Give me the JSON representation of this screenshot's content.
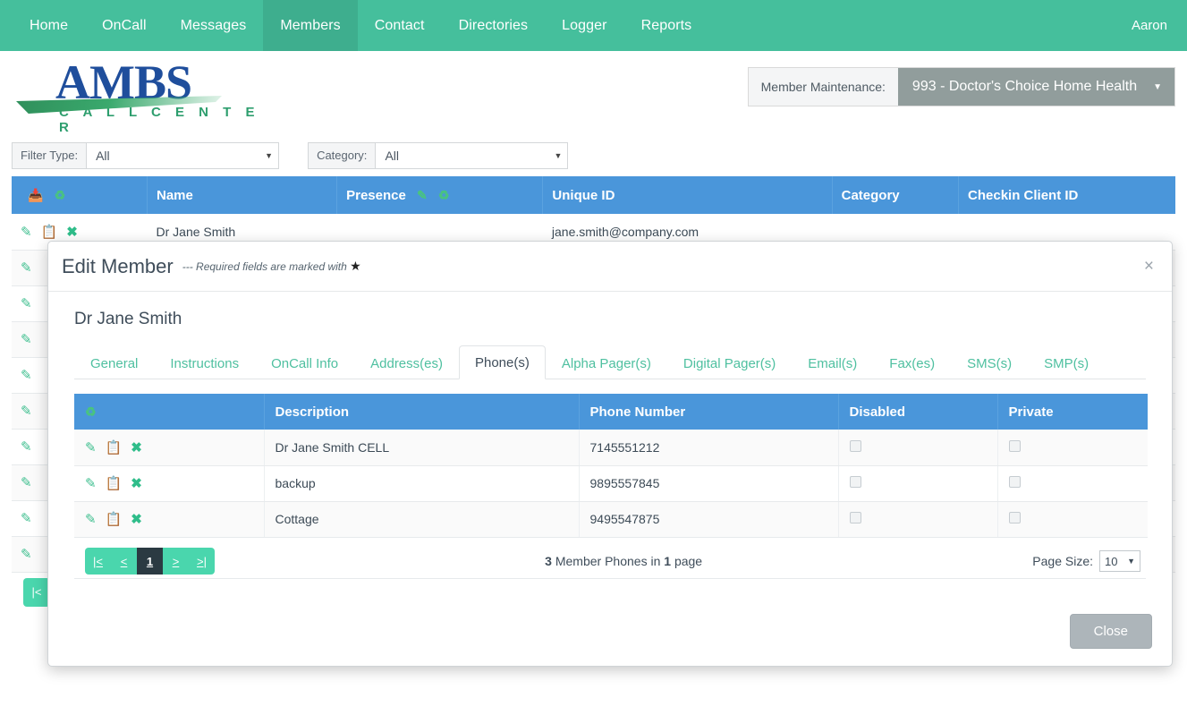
{
  "nav": {
    "items": [
      {
        "label": "Home",
        "active": false
      },
      {
        "label": "OnCall",
        "active": false
      },
      {
        "label": "Messages",
        "active": false
      },
      {
        "label": "Members",
        "active": true
      },
      {
        "label": "Contact",
        "active": false
      },
      {
        "label": "Directories",
        "active": false
      },
      {
        "label": "Logger",
        "active": false
      },
      {
        "label": "Reports",
        "active": false
      }
    ],
    "user": "Aaron"
  },
  "brand": {
    "name": "AMBS",
    "tagline": "C A L L   C E N T E R"
  },
  "member_maintenance": {
    "label": "Member Maintenance:",
    "selected": "993 - Doctor's Choice Home Health",
    "caret": "chevron-down-icon"
  },
  "filters": {
    "filter_type": {
      "label": "Filter Type:",
      "value": "All"
    },
    "category": {
      "label": "Category:",
      "value": "All"
    }
  },
  "main_grid": {
    "columns": [
      {
        "key": "actions",
        "label": ""
      },
      {
        "key": "name",
        "label": "Name"
      },
      {
        "key": "presence",
        "label": "Presence"
      },
      {
        "key": "unique_id",
        "label": "Unique ID"
      },
      {
        "key": "category",
        "label": "Category"
      },
      {
        "key": "checkin",
        "label": "Checkin Client ID"
      }
    ],
    "header_icons": [
      "add-member-icon",
      "refresh-icon"
    ],
    "presence_icons": [
      "edit-icon",
      "refresh-icon"
    ],
    "rows": [
      {
        "name": "Dr Jane Smith",
        "presence": "",
        "unique_id": "jane.smith@company.com",
        "category": "",
        "checkin": ""
      },
      {
        "name": "",
        "presence": "",
        "unique_id": "",
        "category": "",
        "checkin": ""
      },
      {
        "name": "",
        "presence": "",
        "unique_id": "",
        "category": "",
        "checkin": ""
      },
      {
        "name": "",
        "presence": "",
        "unique_id": "",
        "category": "",
        "checkin": ""
      },
      {
        "name": "",
        "presence": "",
        "unique_id": "",
        "category": "",
        "checkin": ""
      },
      {
        "name": "",
        "presence": "",
        "unique_id": "",
        "category": "",
        "checkin": ""
      },
      {
        "name": "",
        "presence": "",
        "unique_id": "",
        "category": "",
        "checkin": ""
      },
      {
        "name": "",
        "presence": "",
        "unique_id": "",
        "category": "",
        "checkin": ""
      },
      {
        "name": "",
        "presence": "",
        "unique_id": "",
        "category": "",
        "checkin": ""
      },
      {
        "name": "",
        "presence": "",
        "unique_id": "",
        "category": "",
        "checkin": ""
      }
    ],
    "row_actions": [
      "edit-icon",
      "copy-icon",
      "delete-icon"
    ],
    "pager": [
      "|<"
    ]
  },
  "modal": {
    "title": "Edit Member",
    "required_note": "--- Required fields are marked with",
    "required_star": "★",
    "close_icon": "×",
    "member_name": "Dr Jane Smith",
    "tabs": [
      {
        "label": "General",
        "active": false
      },
      {
        "label": "Instructions",
        "active": false
      },
      {
        "label": "OnCall Info",
        "active": false
      },
      {
        "label": "Address(es)",
        "active": false
      },
      {
        "label": "Phone(s)",
        "active": true
      },
      {
        "label": "Alpha Pager(s)",
        "active": false
      },
      {
        "label": "Digital Pager(s)",
        "active": false
      },
      {
        "label": "Email(s)",
        "active": false
      },
      {
        "label": "Fax(es)",
        "active": false
      },
      {
        "label": "SMS(s)",
        "active": false
      },
      {
        "label": "SMP(s)",
        "active": false
      }
    ],
    "phones_grid": {
      "header_icon": "refresh-icon",
      "columns": [
        {
          "key": "actions",
          "label": ""
        },
        {
          "key": "description",
          "label": "Description"
        },
        {
          "key": "phone_number",
          "label": "Phone Number"
        },
        {
          "key": "disabled",
          "label": "Disabled"
        },
        {
          "key": "private",
          "label": "Private"
        }
      ],
      "row_actions": [
        "edit-icon",
        "copy-icon",
        "delete-icon"
      ],
      "rows": [
        {
          "description": "Dr Jane Smith CELL",
          "phone_number": "7145551212",
          "disabled": false,
          "private": false
        },
        {
          "description": "backup",
          "phone_number": "9895557845",
          "disabled": false,
          "private": false
        },
        {
          "description": "Cottage",
          "phone_number": "9495547875",
          "disabled": false,
          "private": false
        }
      ]
    },
    "pagination": {
      "first": "|<",
      "prev": "<",
      "current": "1",
      "next": ">",
      "last": ">|",
      "summary_count": "3",
      "summary_mid": "Member Phones in",
      "summary_pages": "1",
      "summary_tail": "page",
      "summary_full": "3 Member Phones in 1 page",
      "page_size_label": "Page Size:",
      "page_size_value": "10"
    },
    "close_button": "Close"
  },
  "colors": {
    "nav_teal": "#45bf9c",
    "nav_active": "#3eae8e",
    "grid_blue": "#4a96da",
    "accent_green": "#3fbf8f",
    "pager_teal": "#4ad6ad",
    "brand_blue": "#1f4e9c",
    "brand_green": "#2e9e6e",
    "select_gray": "#919d9c"
  }
}
